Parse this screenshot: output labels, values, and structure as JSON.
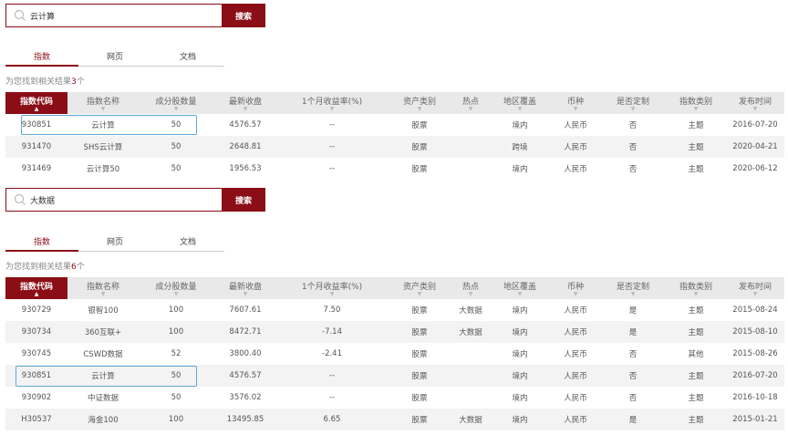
{
  "search1": {
    "value": "云计算",
    "button": "搜索"
  },
  "tabs1": [
    {
      "label": "指数"
    },
    {
      "label": "网页"
    },
    {
      "label": "文档"
    }
  ],
  "result1": {
    "prefix": "为您找到相关结果",
    "count": "3",
    "suffix": "个"
  },
  "columns": [
    "指数代码",
    "指数名称",
    "成分股数量",
    "最新收盘",
    "1个月收益率(%)",
    "资产类别",
    "热点",
    "地区覆盖",
    "币种",
    "是否定制",
    "指数类别",
    "发布时间"
  ],
  "table1": [
    [
      "930851",
      "云计算",
      "50",
      "4576.57",
      "--",
      "股票",
      "",
      "境内",
      "人民币",
      "否",
      "主题",
      "2016-07-20"
    ],
    [
      "931470",
      "SHS云计算",
      "50",
      "2648.81",
      "--",
      "股票",
      "",
      "跨境",
      "人民币",
      "否",
      "主题",
      "2020-04-21"
    ],
    [
      "931469",
      "云计算50",
      "50",
      "1956.53",
      "--",
      "股票",
      "",
      "境内",
      "人民币",
      "否",
      "主题",
      "2020-06-12"
    ]
  ],
  "search2": {
    "value": "大数据",
    "button": "搜索"
  },
  "tabs2": [
    {
      "label": "指数"
    },
    {
      "label": "网页"
    },
    {
      "label": "文档"
    }
  ],
  "result2": {
    "prefix": "为您找到相关结果",
    "count": "6",
    "suffix": "个"
  },
  "table2": [
    [
      "930729",
      "银智100",
      "100",
      "7607.61",
      "7.50",
      "股票",
      "大数据",
      "境内",
      "人民币",
      "是",
      "主题",
      "2015-08-24"
    ],
    [
      "930734",
      "360互联+",
      "100",
      "8472.71",
      "-7.14",
      "股票",
      "大数据",
      "境内",
      "人民币",
      "是",
      "主题",
      "2015-08-10"
    ],
    [
      "930745",
      "CSWD数据",
      "52",
      "3800.40",
      "-2.41",
      "股票",
      "",
      "境内",
      "人民币",
      "否",
      "其他",
      "2015-08-26"
    ],
    [
      "930851",
      "云计算",
      "50",
      "4576.57",
      "--",
      "股票",
      "",
      "境内",
      "人民币",
      "否",
      "主题",
      "2016-07-20"
    ],
    [
      "930902",
      "中证数据",
      "50",
      "3576.02",
      "--",
      "股票",
      "",
      "境内",
      "人民币",
      "否",
      "主题",
      "2016-10-18"
    ],
    [
      "H30537",
      "海金100",
      "100",
      "13495.85",
      "6.65",
      "股票",
      "大数据",
      "境内",
      "人民币",
      "是",
      "主题",
      "2015-01-21"
    ]
  ],
  "colors": {
    "accent": "#8b0e16",
    "highlight": "#5fa8d3"
  },
  "icons": {
    "search": "search-icon",
    "sort": "sort-arrow-icon"
  }
}
